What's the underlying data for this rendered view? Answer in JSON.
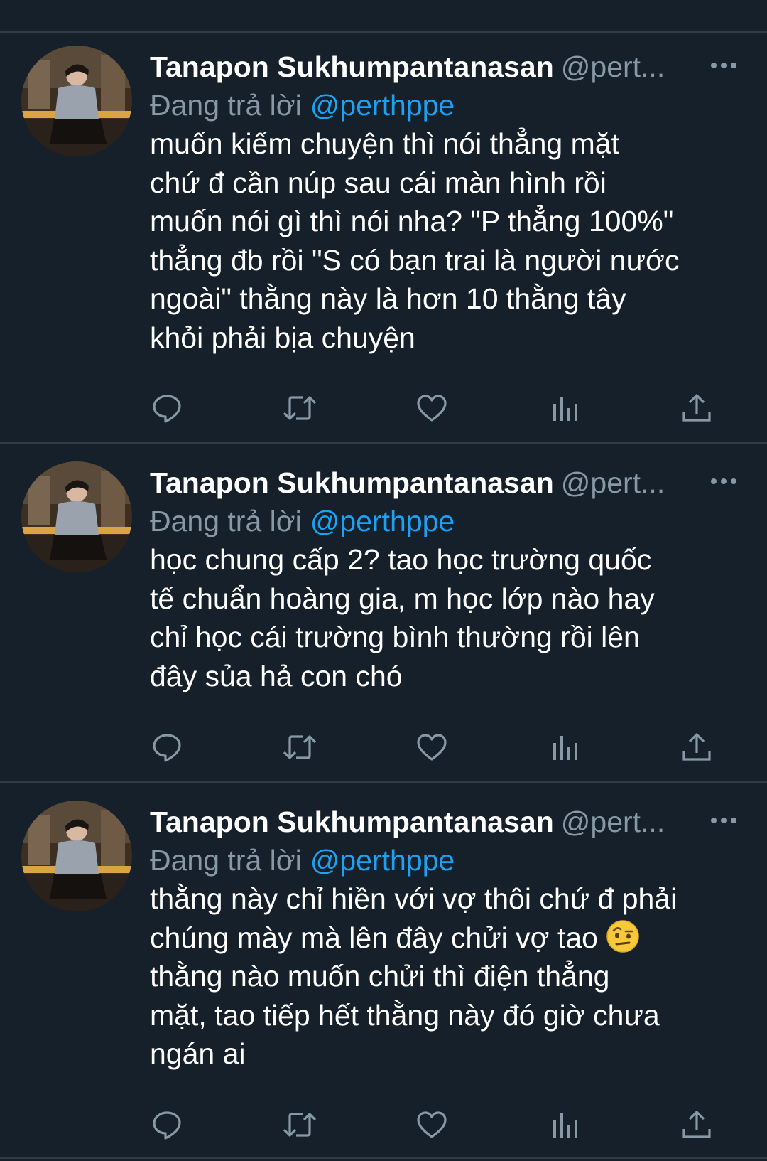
{
  "colors": {
    "background": "#15202b",
    "divider": "#2f3b47",
    "text_primary": "#ffffff",
    "text_secondary": "#8899a6",
    "accent": "#1da1f2"
  },
  "tweets": [
    {
      "author_name": "Tanapon Sukhumpantanasan",
      "author_handle": "@pert...",
      "reply_prefix": "Đang trả lời",
      "reply_mention": "@perthppe",
      "text_lines": [
        "muốn kiếm chuyện thì nói thẳng mặt",
        "chứ đ cần núp sau cái màn hình rồi",
        "muốn nói gì thì nói nha? \"P thẳng 100%\"",
        "thẳng đb rồi \"S có bạn trai là người nước",
        "ngoài\" thằng này là hơn 10 thằng tây",
        "khỏi phải bịa chuyện"
      ]
    },
    {
      "author_name": "Tanapon Sukhumpantanasan",
      "author_handle": "@pert...",
      "reply_prefix": "Đang trả lời",
      "reply_mention": "@perthppe",
      "text_lines": [
        "học chung cấp 2? tao học trường quốc",
        "tế chuẩn hoàng gia, m học lớp nào hay",
        "chỉ học cái trường bình thường rồi lên",
        "đây sủa hả con chó"
      ]
    },
    {
      "author_name": "Tanapon Sukhumpantanasan",
      "author_handle": "@pert...",
      "reply_prefix": "Đang trả lời",
      "reply_mention": "@perthppe",
      "text_lines": [
        "thằng này chỉ hiền với vợ thôi chứ đ phải",
        "chúng mày mà lên đây chửi vợ tao",
        "thằng nào muốn chửi thì điện thẳng",
        "mặt, tao tiếp hết thằng này đó giờ chưa",
        "ngán ai"
      ],
      "emoji_after_line": 1,
      "emoji": "face-with-raised-eyebrow-emoji"
    }
  ],
  "icons": {
    "more": "more-dots-icon",
    "reply": "reply-bubble-icon",
    "retweet": "retweet-icon",
    "like": "heart-icon",
    "analytics": "analytics-bars-icon",
    "share": "share-upload-icon"
  }
}
